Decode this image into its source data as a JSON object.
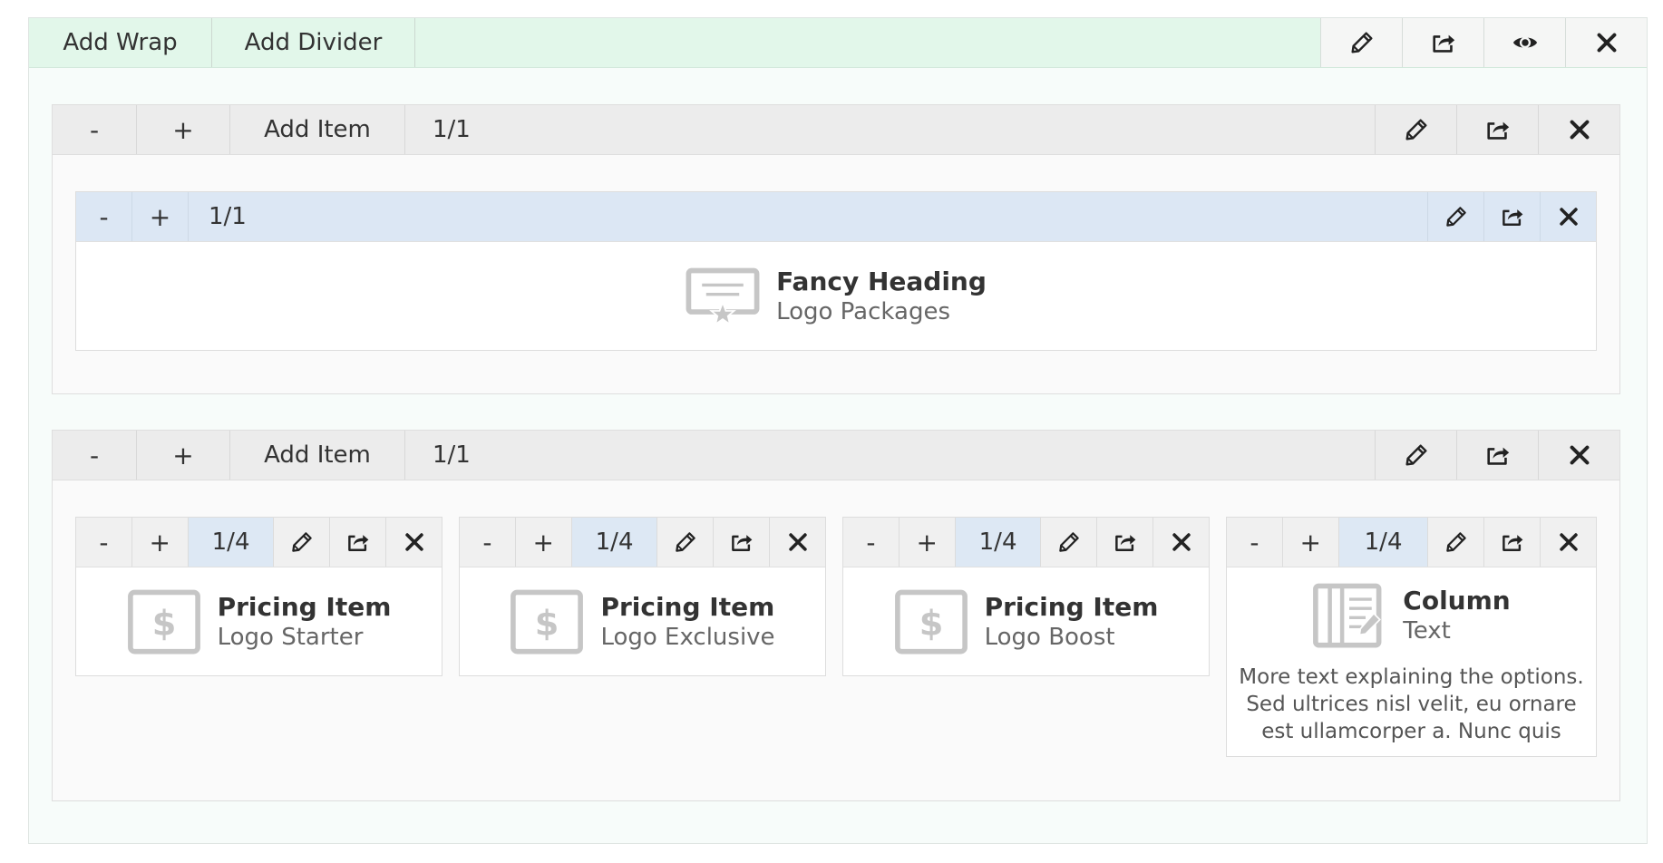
{
  "wrap": {
    "add_wrap_label": "Add Wrap",
    "add_divider_label": "Add Divider",
    "accent_color": "#e2f7ea"
  },
  "rows": [
    {
      "minus_label": "-",
      "plus_label": "+",
      "add_item_label": "Add Item",
      "fraction": "1/1",
      "columns": [
        {
          "minus_label": "-",
          "plus_label": "+",
          "fraction": "1/1",
          "module": {
            "icon": "fancy-heading-icon",
            "title": "Fancy Heading",
            "subtitle": "Logo Packages"
          }
        }
      ]
    },
    {
      "minus_label": "-",
      "plus_label": "+",
      "add_item_label": "Add Item",
      "fraction": "1/1",
      "columns": [
        {
          "minus_label": "-",
          "plus_label": "+",
          "fraction": "1/4",
          "module": {
            "icon": "pricing-dollar-icon",
            "title": "Pricing Item",
            "subtitle": "Logo Starter"
          }
        },
        {
          "minus_label": "-",
          "plus_label": "+",
          "fraction": "1/4",
          "module": {
            "icon": "pricing-dollar-icon",
            "title": "Pricing Item",
            "subtitle": "Logo Exclusive"
          }
        },
        {
          "minus_label": "-",
          "plus_label": "+",
          "fraction": "1/4",
          "module": {
            "icon": "pricing-dollar-icon",
            "title": "Pricing Item",
            "subtitle": "Logo Boost"
          }
        },
        {
          "minus_label": "-",
          "plus_label": "+",
          "fraction": "1/4",
          "module": {
            "icon": "column-text-icon",
            "title": "Column",
            "subtitle": "Text",
            "description": "More text explaining the options. Sed ultrices nisl velit, eu ornare est ullamcorper a. Nunc quis"
          }
        }
      ]
    }
  ]
}
